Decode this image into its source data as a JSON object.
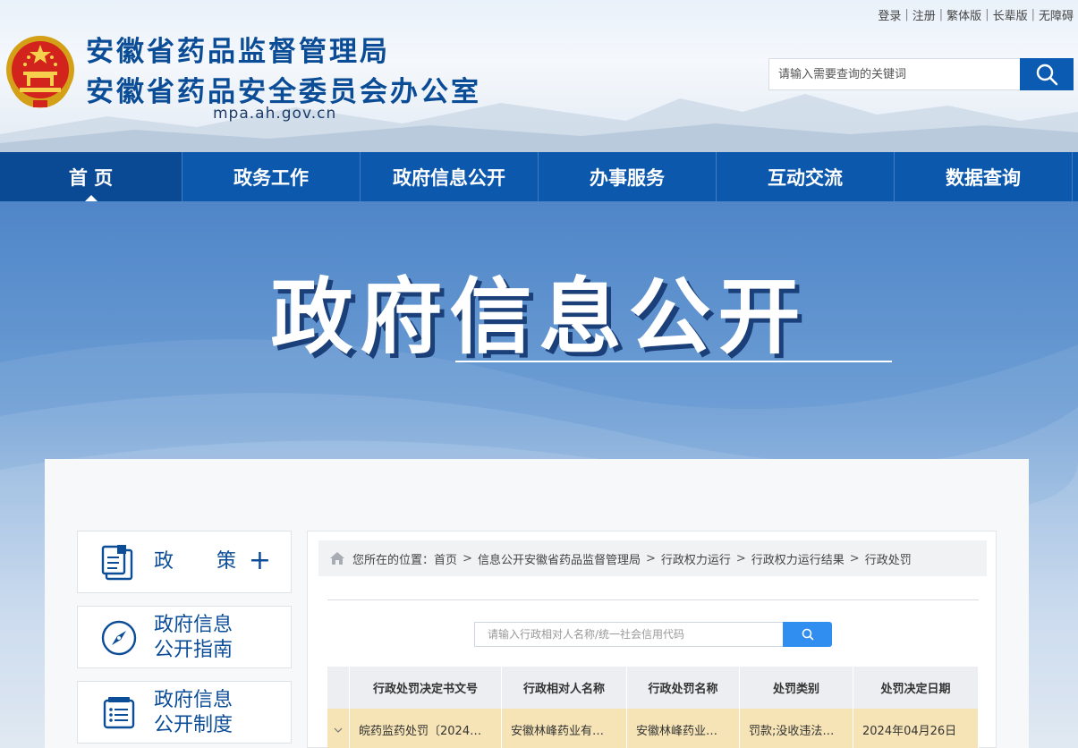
{
  "header": {
    "title_line1": "安徽省药品监督管理局",
    "title_line2": "安徽省药品安全委员会办公室",
    "domain": "mpa.ah.gov.cn",
    "top_links": [
      "登录",
      "注册",
      "繁体版",
      "长辈版",
      "无障碍"
    ],
    "search_placeholder": "请输入需要查询的关键词"
  },
  "nav": {
    "items": [
      "首 页",
      "政务工作",
      "政府信息公开",
      "办事服务",
      "互动交流",
      "数据查询"
    ],
    "active_index": 0
  },
  "banner": {
    "title": "政府信息公开"
  },
  "sidebar": {
    "items": [
      {
        "label": "政策",
        "icon": "policy-document-icon",
        "expand": "+"
      },
      {
        "label": "政府信息\n公开指南",
        "icon": "compass-icon"
      },
      {
        "label": "政府信息\n公开制度",
        "icon": "list-document-icon"
      }
    ]
  },
  "main": {
    "breadcrumb_prefix": "您所在的位置：",
    "breadcrumb": [
      "首页",
      "信息公开安徽省药品监督管理局",
      "行政权力运行",
      "行政权力运行结果",
      "行政处罚"
    ],
    "filter_placeholder": "请输入行政相对人名称/统一社会信用代码",
    "table": {
      "columns": [
        "行政处罚决定书文号",
        "行政相对人名称",
        "行政处罚名称",
        "处罚类别",
        "处罚决定日期"
      ],
      "rows": [
        [
          "皖药监药处罚〔2024…",
          "安徽林峰药业有…",
          "安徽林峰药业…",
          "罚款;没收违法…",
          "2024年04月26日"
        ]
      ]
    }
  },
  "colors": {
    "nav_bg": "#0c58ad",
    "title_blue": "#0b4c96",
    "row_highlight": "#f6e4b6",
    "search_button": "#0b5bb3"
  }
}
